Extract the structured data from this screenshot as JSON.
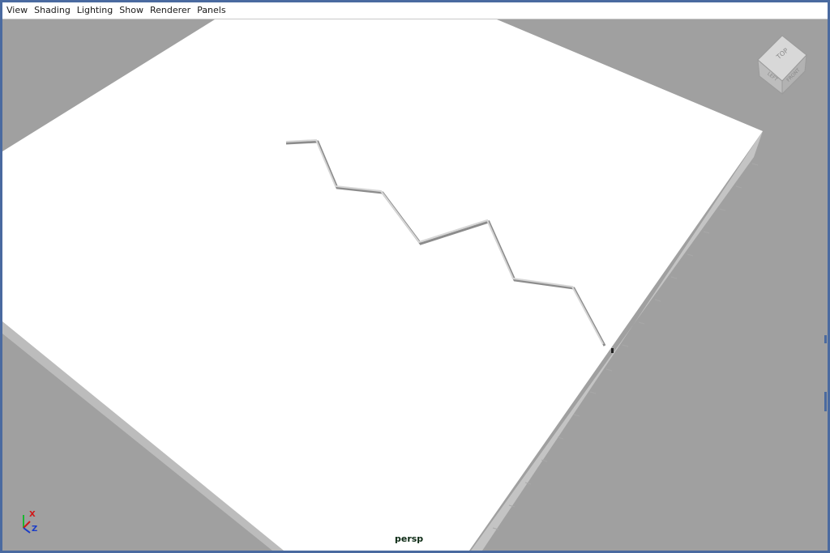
{
  "menu": {
    "items": [
      "View",
      "Shading",
      "Lighting",
      "Show",
      "Renderer",
      "Panels"
    ]
  },
  "viewport": {
    "camera_label": "persp",
    "background_color": "#a0a0a0",
    "plane_color": "#ffffff"
  },
  "view_cube": {
    "top_label": "TOP",
    "left_label": "LEFT",
    "front_label": "FRONT"
  },
  "axis_indicator": {
    "x_label": "X",
    "z_label": "Z",
    "x_color": "#d01818",
    "y_color": "#18b830",
    "z_color": "#1a3cc8"
  }
}
